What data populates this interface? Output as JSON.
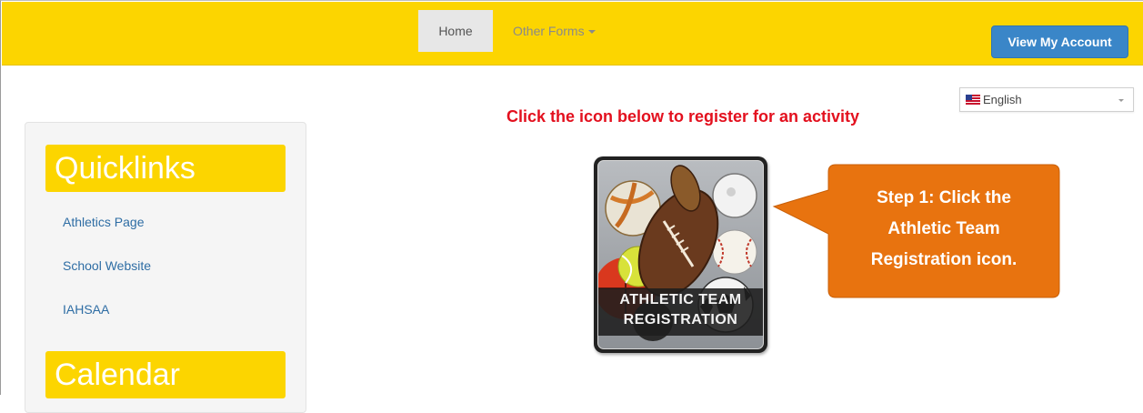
{
  "nav": {
    "home_label": "Home",
    "other_forms_label": "Other Forms",
    "view_account_label": "View My Account"
  },
  "language": {
    "selected": "English",
    "flag_icon": "us-flag-icon"
  },
  "sidebar": {
    "quicklinks_title": "Quicklinks",
    "links": [
      {
        "label": "Athletics Page"
      },
      {
        "label": "School Website"
      },
      {
        "label": "IAHSAA"
      }
    ],
    "calendar_title": "Calendar"
  },
  "main": {
    "instruction": "Click the icon below to register for an activity",
    "tile": {
      "line1": "ATHLETIC TEAM",
      "line2": "REGISTRATION"
    }
  },
  "callout": {
    "line1": "Step 1: Click the",
    "line2": "Athletic Team",
    "line3": "Registration icon."
  },
  "colors": {
    "brand_yellow": "#fcd500",
    "button_blue": "#3a86c8",
    "instruction_red": "#e3101e",
    "callout_orange": "#e8730f",
    "link_blue": "#2e6da4"
  }
}
